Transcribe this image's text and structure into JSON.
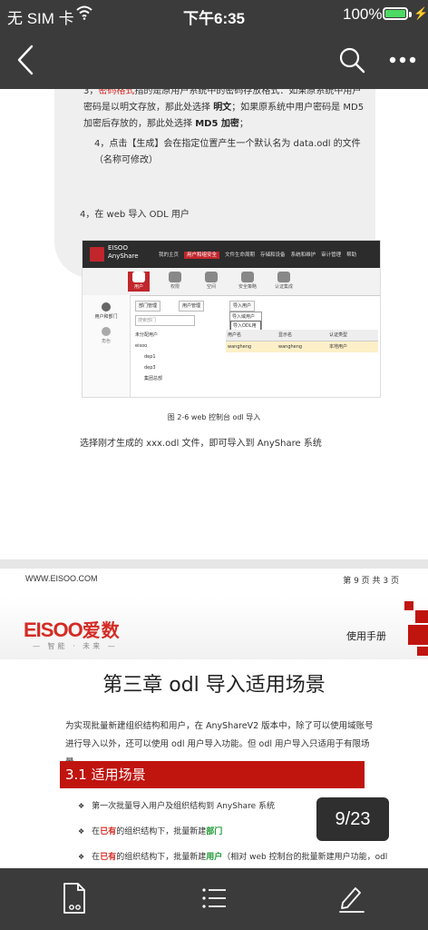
{
  "status_bar": {
    "carrier": "无 SIM 卡",
    "time": "下午6:35",
    "battery_pct": "100%",
    "battery_level": 1.0,
    "icons": [
      "wifi-icon",
      "battery-icon",
      "charging-icon"
    ]
  },
  "nav": {
    "icons": [
      "back-icon",
      "search-icon",
      "more-icon"
    ]
  },
  "document": {
    "step3_prefix": "3，",
    "step3_red": "密码格式",
    "step3_rest": "指的是原用户系统中的密码存放格式：如果原系统中用户密码是以明文存放，那此处选择",
    "step3_bold1": "明文",
    "step3_rest2": "；如果原系统中用户密码是 MD5 加密后存放的，那此处选择",
    "step3_bold2": "MD5 加密",
    "step3_end": "；",
    "step4": "4，点击【生成】会在指定位置产生一个默认名为 data.odl 的文件（名称可修改）",
    "web_import_heading": "4，在 web 导入 ODL 用户",
    "screenshot": {
      "brand_line1": "EISOO",
      "brand_line2": "AnyShare",
      "menu": [
        "我的主页",
        "用户和组安全",
        "文件生命周期",
        "存储和设备",
        "系统和维护",
        "审计管理",
        "帮助"
      ],
      "tabs": [
        "用户",
        "权限",
        "空间",
        "安全策略",
        "认证集成"
      ],
      "side": [
        "用户和部门",
        "角色"
      ],
      "btn_dept": "部门管理",
      "btn_user": "用户管理",
      "btn_import": "导入用户",
      "dropdown": [
        "导入域用户",
        "导入ODL用户"
      ],
      "search_placeholder": "搜索部门",
      "tree": [
        "未分配用户",
        "eisoo",
        "dep1",
        "dep3",
        "集团总部"
      ],
      "table_headers": [
        "用户名",
        "显示名",
        "认证类型"
      ],
      "table_row": [
        "wangheng",
        "wangheng",
        "本地用户"
      ]
    },
    "caption": "图 2-6 web 控制台 odl 导入",
    "select_text": "选择刚才生成的 xxx.odl 文件，即可导入到 AnyShare 系统",
    "footer_site": "WWW.EISOO.COM",
    "footer_page": "第 9 页 共 3 页",
    "logo_en": "EISOO",
    "logo_cn": "爱数",
    "slogan": "— 智能 · 未来 —",
    "manual": "使用手册",
    "chapter_title": "第三章  odl 导入适用场景",
    "intro": "为实现批量新建组织结构和用户，在 AnyShareV2 版本中，除了可以使用域账号进行导入以外，还可以使用 odl 用户导入功能。但 odl 用户导入只适用于有限场景",
    "section_title": "3.1  适用场景",
    "bullet1": "第一次批量导入用户及组织结构到 AnyShare 系统",
    "bullet2_a": "在",
    "bullet2_red": "已有",
    "bullet2_b": "的组织结构下，批量新建",
    "bullet2_green": "部门",
    "bullet3_a": "在",
    "bullet3_red": "已有",
    "bullet3_b": "的组织结构下，批量新建",
    "bullet3_green": "用户",
    "bullet3_c": "（相对 web 控制台的批量新建用户功能，odl"
  },
  "page_indicator": "9/23",
  "toolbar": {
    "icons": [
      "document-icon",
      "list-icon",
      "annotate-icon"
    ]
  },
  "colors": {
    "bar_bg": "#3b3b3b",
    "accent_red": "#c0140f",
    "battery_green": "#4cd964"
  }
}
